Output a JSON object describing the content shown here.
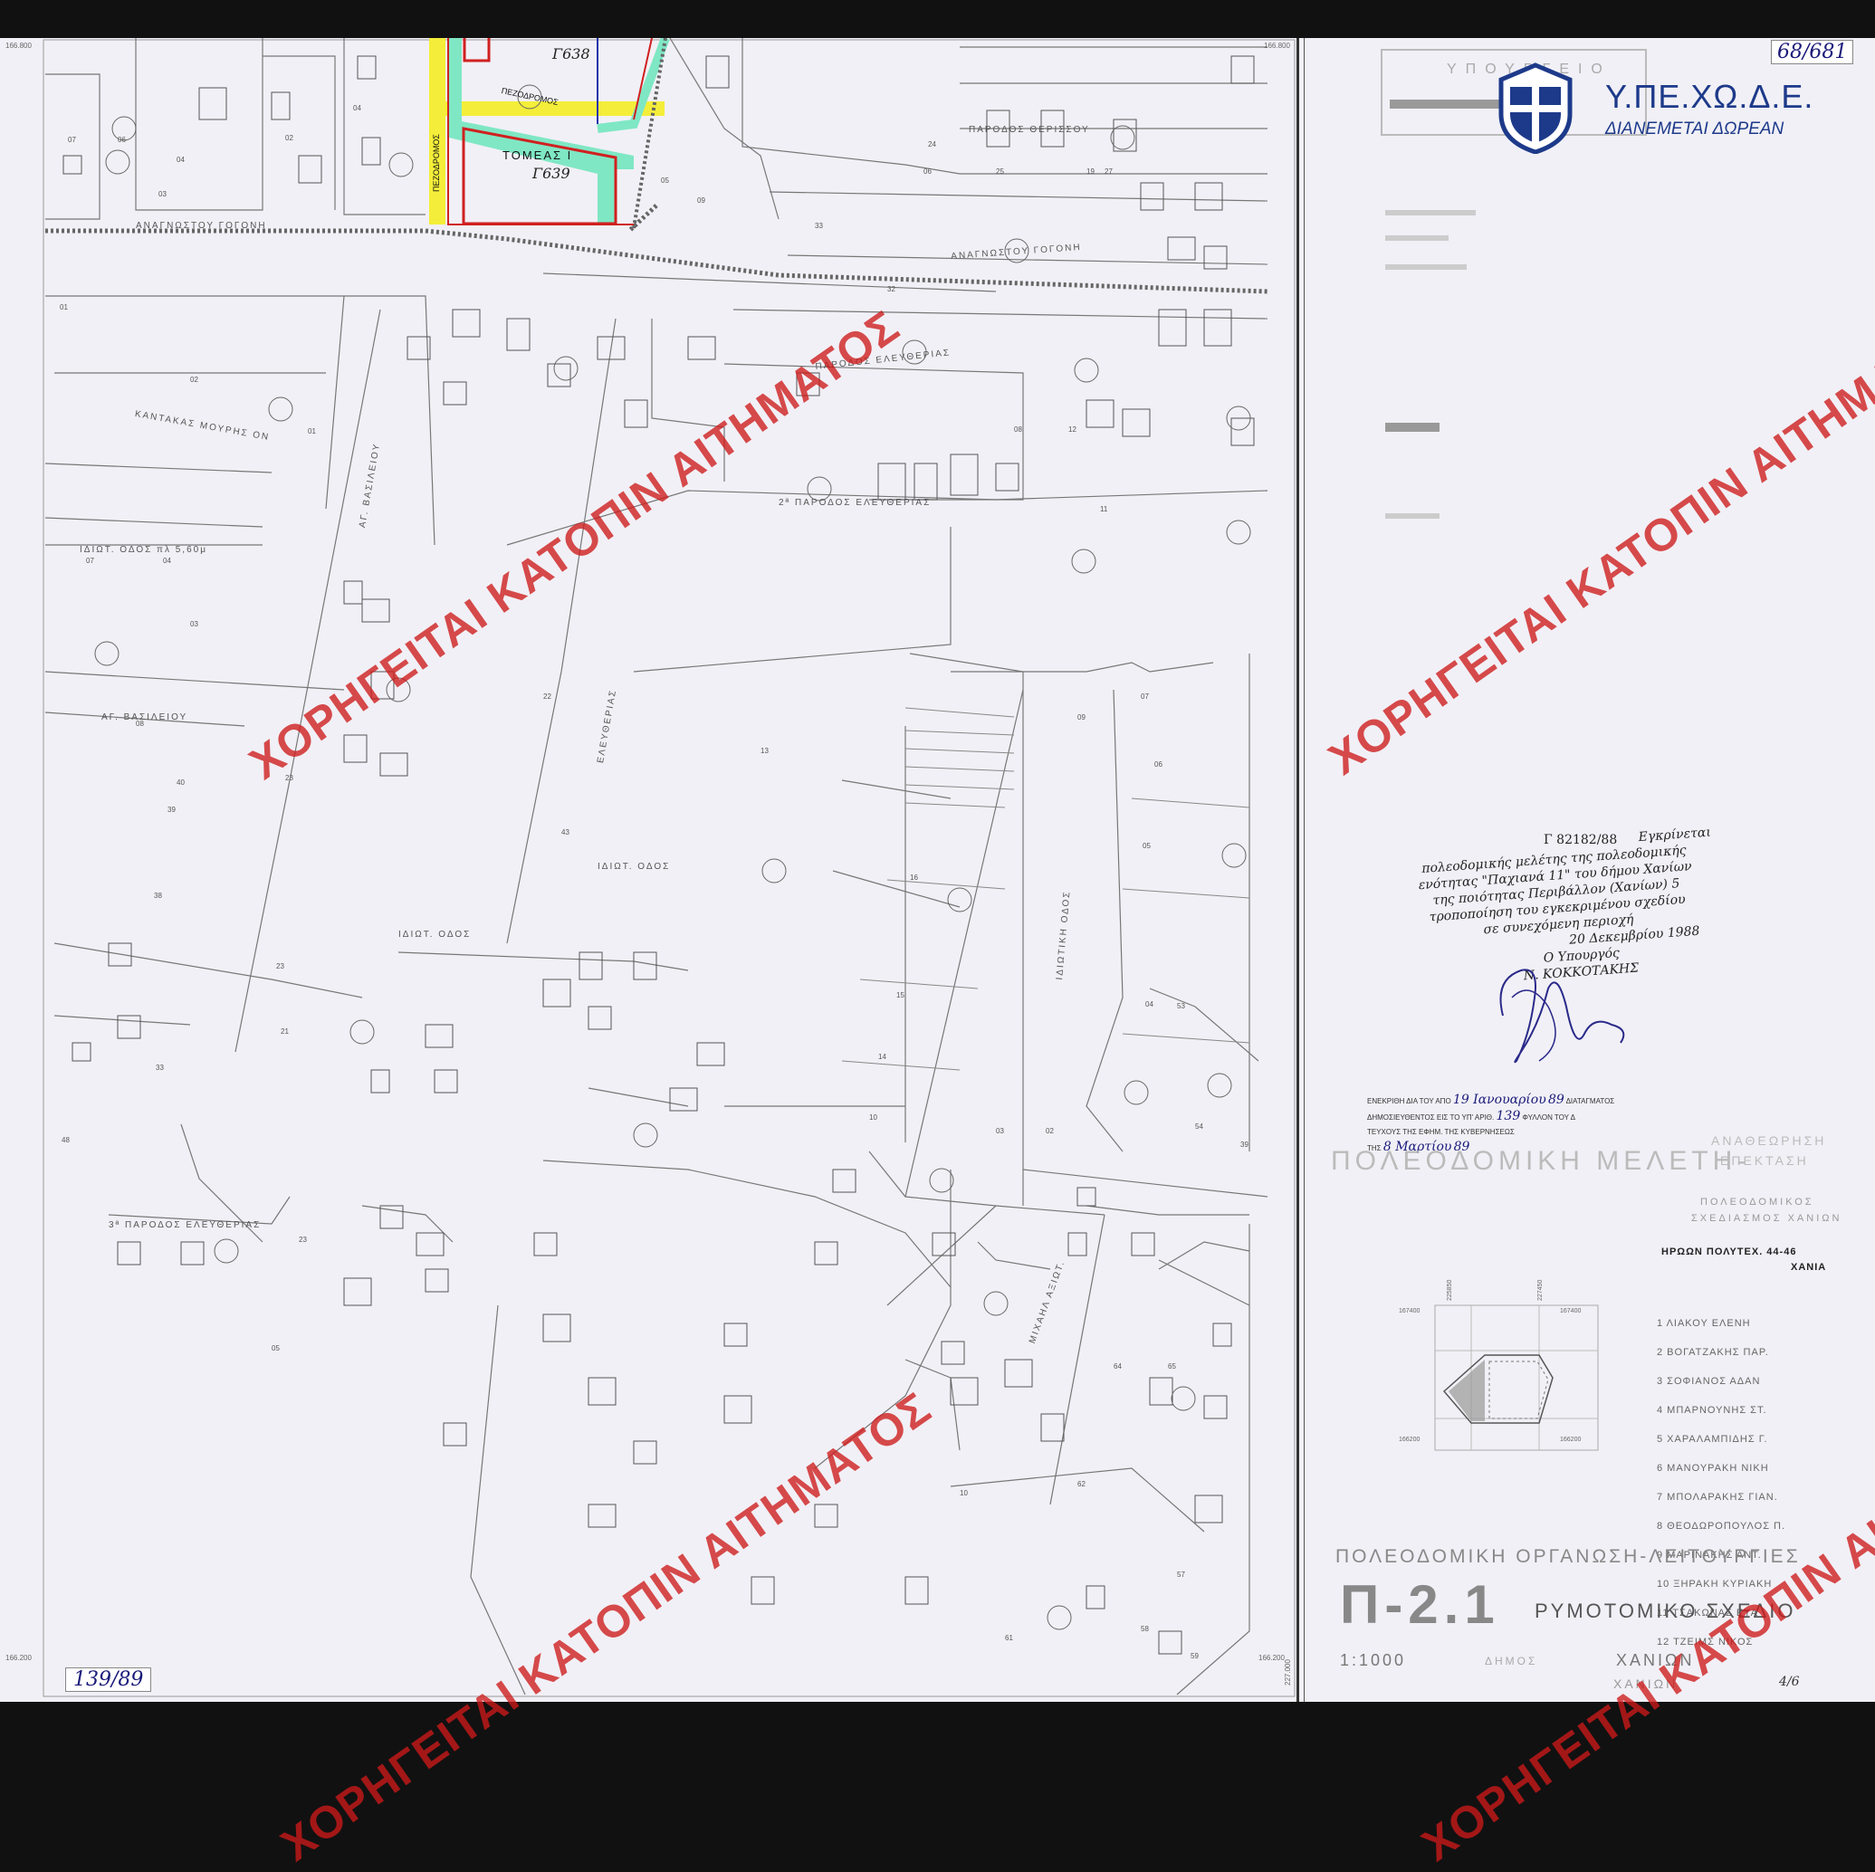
{
  "sheet": {
    "ref_top_right": "68/681",
    "ref_bottom_left": "139/89",
    "page_mark_bottom_right": "4/6",
    "ministry_logo": "Υ.ΠΕ.ΧΩ.Δ.Ε.",
    "ministry_logo_sub": "ΔΙΑΝΕΜΕΤΑΙ ΔΩΡΕΑΝ",
    "watermark": "ΧΟΡΗΓΕΙΤΑΙ ΚΑΤΟΠΙΝ ΑΙΤΗΜΑΤΟΣ",
    "colors": {
      "watermark": "#cd1919",
      "highlight_yellow": "#f4ee3a",
      "highlight_cyan": "#7fe7c4",
      "block_outline": "#d02020",
      "logo_blue": "#1d3a8a"
    }
  },
  "map": {
    "sector_label": "ΤΟΜΕΑΣ Ι",
    "sector_code_1": "Γ639",
    "sector_code_2": "Γ638",
    "pedestrian_1": "ΠΕΖΟΔΡΟΜΟΣ",
    "pedestrian_2": "ΠΕΖΟΔΡΟΜΟΣ",
    "streets": {
      "s1": "ΑΝΑΓΝΩΣΤΟΥ ΓΟΓΟΝΗ",
      "s2": "ΑΝΑΓΝΩΣΤΟΥ ΓΟΓΟΝΗ",
      "s3": "ΠΑΡΟΔΟΣ ΕΛΕΥΘΕΡΙΑΣ",
      "s4": "2ª ΠΑΡΟΔΟΣ ΕΛΕΥΘΕΡΙΑΣ",
      "s5": "3ª ΠΑΡΟΔΟΣ ΕΛΕΥΘΕΡΙΑΣ",
      "s6": "ΕΛΕΥΘΕΡΙΑΣ",
      "s7": "ΑΓ. ΒΑΣΙΛΕΙΟΥ",
      "s8": "ΑΓ. ΒΑΣΙΛΕΙΟΥ",
      "s9": "ΙΔΙΩΤ. ΟΔΟΣ πλ 5,60μ",
      "s10": "ΙΔΙΩΤ. ΟΔΟΣ",
      "s11": "ΙΔΙΩΤ. ΟΔΟΣ",
      "s12": "ΙΔΙΩΤΙΚΗ ΟΔΟΣ",
      "s13": "ΚΑΝΤΑΚΑΣ ΜΟΥΡΗΣ ΟΝ",
      "s14": "ΠΑΡΟΔΟΣ ΘΕΡΙΣΣΟΥ",
      "s15": "ΜΙΧΑΗΛ ΑΞΙΩΤ."
    }
  },
  "title_block": {
    "header": "ΥΠΟΥΡΓΕΙΟ",
    "approval_ref": "Γ 82182/88",
    "approval_lines": [
      "Εγκρίνεται",
      "πολεοδομικής μελέτης της πολεοδομικής",
      "ενότητας \"Παχιανά 11\" του δήμου Χανίων",
      "της ποιότητας Περιβάλλον (Χανίων) 5",
      "τροποποίηση του εγκεκριμένου σχεδίου",
      "σε συνεχόμενη περιοχή",
      "20 Δεκεμβρίου 1988"
    ],
    "signer_title": "Ο Υπουργός",
    "signer": "Ν. ΚΟΚΚΟΤΑΚΗΣ",
    "gazette_line1_pre": "ΕΝΕΚΡΙΘΗ ΔΙΑ ΤΟΥ ΑΠΟ",
    "gazette_date": "19 Ιανουαρίου",
    "gazette_year": "89",
    "gazette_line1_post": "ΔΙΑΤΑΓΜΑΤΟΣ",
    "gazette_line2_pre": "ΔΗΜΟΣΙΕΥΘΕΝΤΟΣ ΕΙΣ ΤΟ ΥΠ' ΑΡΙΘ.",
    "gazette_no": "139",
    "gazette_line2_post": "ΦΥΛΛΟΝ ΤΟΥ Δ",
    "gazette_line3": "ΤΕΥΧΟΥΣ ΤΗΣ ΕΦΗΜ. ΤΗΣ ΚΥΒΕΡΝΗΣΕΩΣ",
    "gazette_line4_pre": "ΤΗΣ",
    "gazette_pub_date": "8 Μαρτίου",
    "gazette_pub_year": "89",
    "study_title": "ΠΟΛΕΟΔΟΜΙΚΗ ΜΕΛΕΤΗ-",
    "study_title_right_1": "ΑΝΑΘΕΩΡΗΣΗ",
    "study_title_right_2": "ΕΠΕΚΤΑΣΗ",
    "planning_line1": "ΠΟΛΕΟΔΟΜΙΚΟΣ",
    "planning_line2": "ΣΧΕΔΙΑΣΜΟΣ ΧΑΝΙΩΝ",
    "address_line1": "ΗΡΩΩΝ ΠΟΛΥΤΕΧ. 44-46",
    "address_line2": "ΧΑΝΙΑ",
    "owners": [
      "1 ΛΙΑΚΟΥ ΕΛΕΝΗ",
      "2 ΒΟΓΑΤΖΑΚΗΣ ΠΑΡ.",
      "3 ΣΟΦΙΑΝΟΣ ΑΔΑΝ",
      "4 ΜΠΑΡΝΟΥΝΗΣ ΣΤ.",
      "5 ΧΑΡΑΛΑΜΠΙΔΗΣ Γ.",
      "6 ΜΑΝΟΥΡΑΚΗ ΝΙΚΗ",
      "7 ΜΠΟΛΑΡΑΚΗΣ ΓΙΑΝ.",
      "8 ΘΕΟΔΩΡΟΠΟΥΛΟΣ Π.",
      "9 ΜΑΡΙΝΑΚΗΣ ΑΝΤ.",
      "10 ΞΗΡΑΚΗ ΚΥΡΙΑΚΗ",
      "11 ΤΣΑΚΩΝΑΣ ΕΥΑ",
      "12 ΤΖΕΙΜΣ ΝΙΚΟΣ"
    ],
    "inset_coords": {
      "c1": "167400",
      "c2": "166200",
      "c3": "225850",
      "c4": "227450",
      "c5": "167400",
      "c6": "166200"
    },
    "map_coords": {
      "top_left": "166.800",
      "top_right": "166.800",
      "bottom_left": "166.200",
      "bottom_right": "166.200",
      "bottom_right_x": "227.000"
    },
    "org_title": "ΠΟΛΕΟΔΟΜΙΚΗ ΟΡΓΑΝΩΣΗ-ΛΕΙΤΟΥΡΓΙΕΣ",
    "sheet_code": "Π-2.1",
    "sheet_name": "ΡΥΜΟΤΟΜΙΚΟ ΣΧΕΔΙΟ",
    "scale": "1:1000",
    "municipality_label": "ΔΗΜΟΣ",
    "municipality": "ΧΑΝΙΩΝ",
    "municipality_sub": "ΧΑΝΙΩΝ"
  }
}
